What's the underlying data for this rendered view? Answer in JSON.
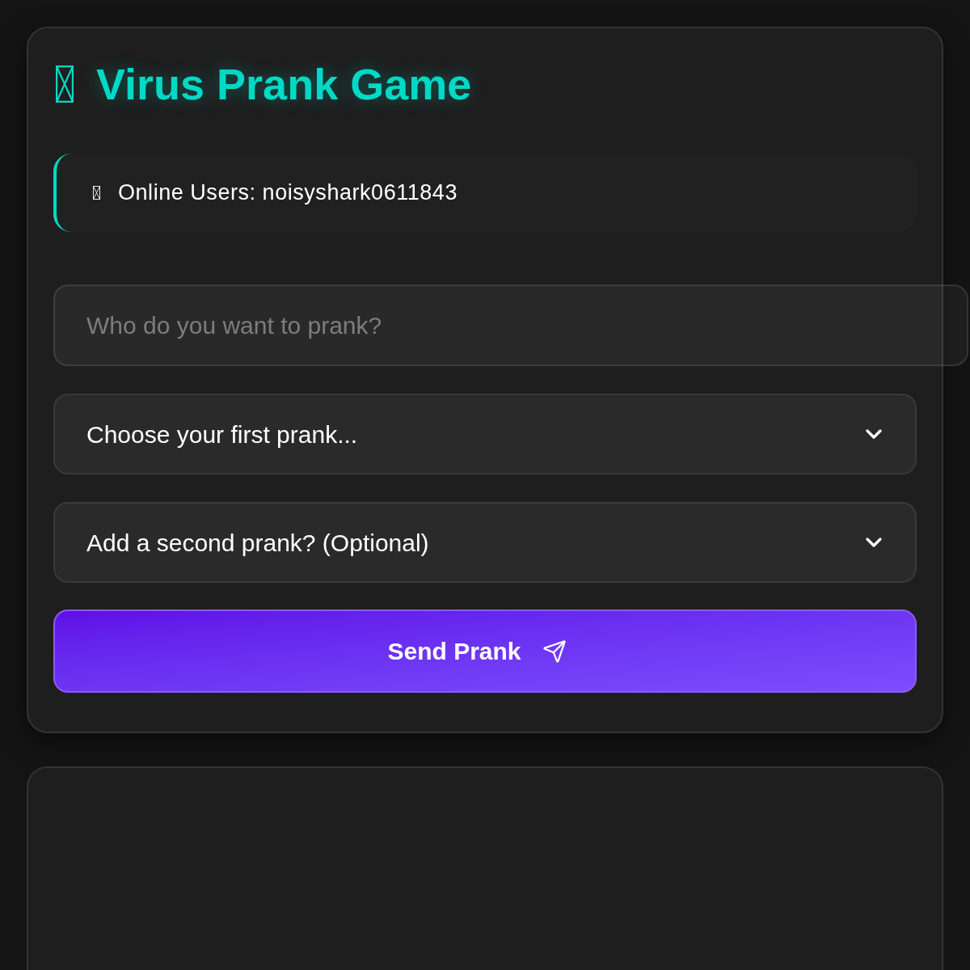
{
  "app": {
    "title": "Virus Prank Game"
  },
  "online_users": {
    "text": "Online Users: noisyshark0611843"
  },
  "target_input": {
    "placeholder": "Who do you want to prank?"
  },
  "selects": [
    {
      "value": "Choose your first prank..."
    },
    {
      "value": "Add a second prank? (Optional)"
    }
  ],
  "send_button": {
    "label": "Send Prank"
  }
}
